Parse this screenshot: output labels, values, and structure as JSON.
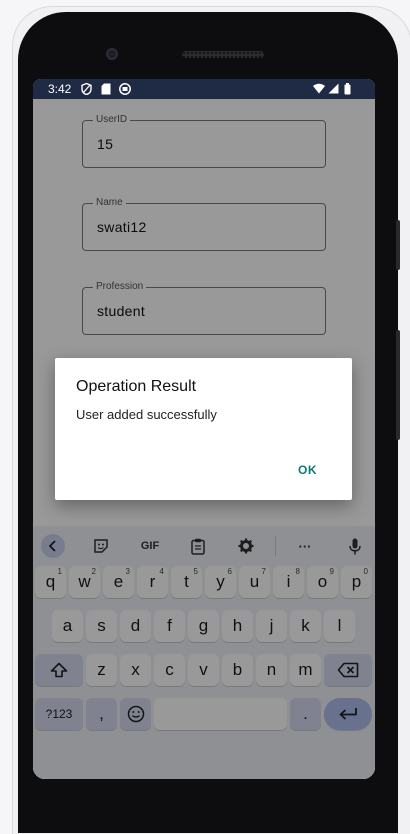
{
  "status_bar": {
    "time": "3:42"
  },
  "form": {
    "fields": [
      {
        "label": "UserID",
        "value": "15"
      },
      {
        "label": "Name",
        "value": "swati12"
      },
      {
        "label": "Profession",
        "value": "student"
      }
    ]
  },
  "dialog": {
    "title": "Operation Result",
    "message": "User added successfully",
    "ok_label": "OK"
  },
  "keyboard": {
    "toolbar": {
      "gif_label": "GIF",
      "more_label": "···"
    },
    "row1": [
      {
        "key": "q",
        "hint": "1"
      },
      {
        "key": "w",
        "hint": "2"
      },
      {
        "key": "e",
        "hint": "3"
      },
      {
        "key": "r",
        "hint": "4"
      },
      {
        "key": "t",
        "hint": "5"
      },
      {
        "key": "y",
        "hint": "6"
      },
      {
        "key": "u",
        "hint": "7"
      },
      {
        "key": "i",
        "hint": "8"
      },
      {
        "key": "o",
        "hint": "9"
      },
      {
        "key": "p",
        "hint": "0"
      }
    ],
    "row2": [
      "a",
      "s",
      "d",
      "f",
      "g",
      "h",
      "j",
      "k",
      "l"
    ],
    "row3": [
      "z",
      "x",
      "c",
      "v",
      "b",
      "n",
      "m"
    ],
    "symbols_label": "?123",
    "comma_label": ",",
    "period_label": "."
  },
  "colors": {
    "accent": "#0b7c73",
    "status_bar": "#1f2a44",
    "keyboard_bg": "#eef0f7"
  }
}
